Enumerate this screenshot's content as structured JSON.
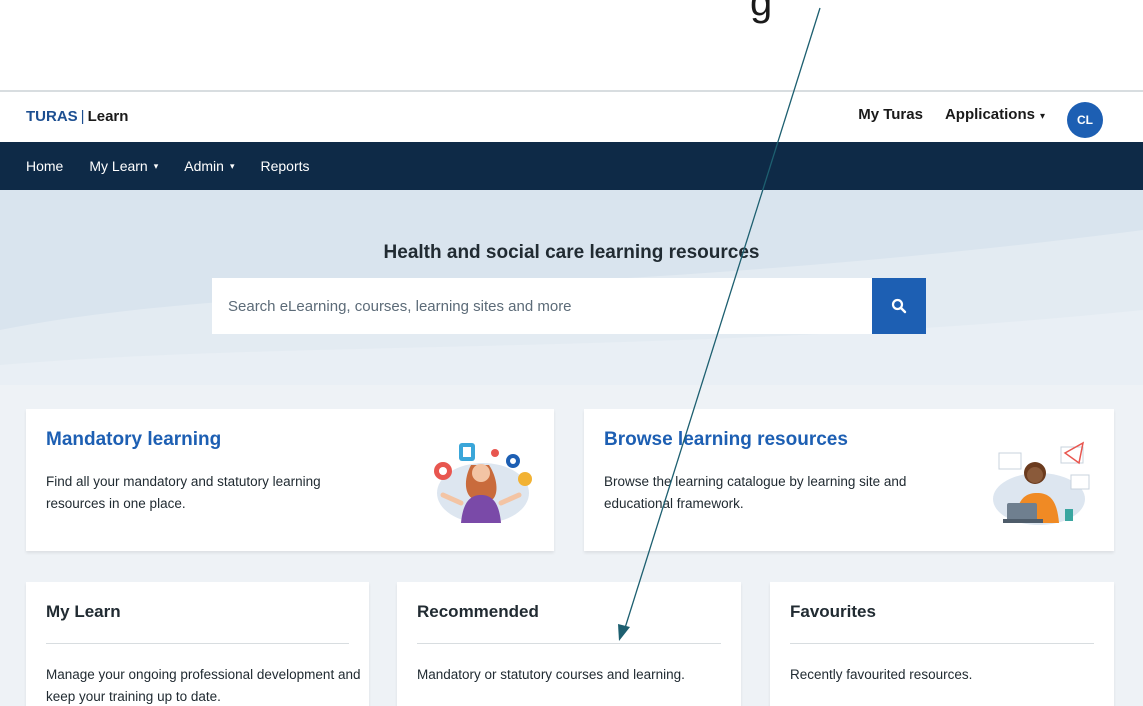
{
  "top_letter": "g",
  "header": {
    "logo_brand": "TURAS",
    "logo_separator": "|",
    "logo_product": "Learn",
    "links": [
      "My Turas",
      "Applications"
    ],
    "avatar_initials": "CL"
  },
  "nav": {
    "items": [
      {
        "label": "Home",
        "dropdown": false
      },
      {
        "label": "My Learn",
        "dropdown": true
      },
      {
        "label": "Admin",
        "dropdown": true
      },
      {
        "label": "Reports",
        "dropdown": false
      }
    ]
  },
  "hero": {
    "title": "Health and social care learning resources",
    "search_placeholder": "Search eLearning, courses, learning sites and more",
    "search_icon": "search-icon"
  },
  "cards_large": [
    {
      "title": "Mandatory learning",
      "text": "Find all your mandatory and statutory learning resources in one place.",
      "illustration": "person-with-icons-illustration"
    },
    {
      "title": "Browse learning resources",
      "text": "Browse the learning catalogue by learning site and educational framework.",
      "illustration": "person-at-laptop-illustration"
    }
  ],
  "cards_small": [
    {
      "title": "My Learn",
      "text": "Manage your ongoing professional development and keep your training up to date."
    },
    {
      "title": "Recommended",
      "text": "Mandatory or statutory courses and learning."
    },
    {
      "title": "Favourites",
      "text": "Recently favourited resources."
    }
  ],
  "colors": {
    "brand_blue": "#1d5fb3",
    "nav_bg": "#0e2a47",
    "hero_bg": "#d9e4ee",
    "body_bg": "#eef2f6",
    "annotation_arrow": "#1d5f70"
  }
}
